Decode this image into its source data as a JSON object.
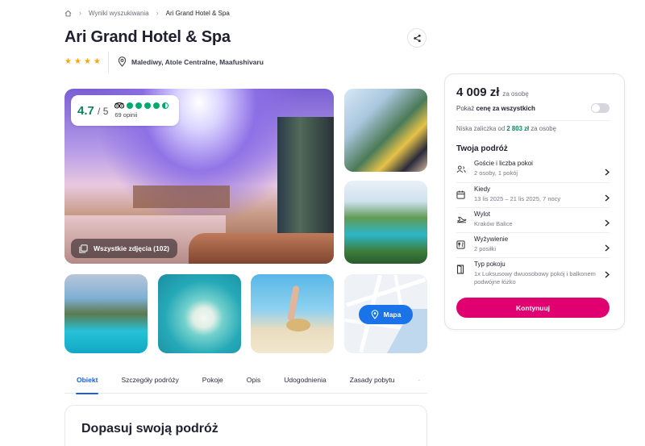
{
  "breadcrumb": {
    "home_icon": "home-icon",
    "items": [
      "Wyniki wyszukiwania",
      "Ari Grand Hotel & Spa"
    ]
  },
  "hotel": {
    "name": "Ari Grand Hotel & Spa",
    "stars": 4,
    "location": "Malediwy, Atole Centralne, Maafushivaru"
  },
  "rating": {
    "score": "4.7",
    "out_of": "/ 5",
    "reviews": "69 opinii",
    "bubbles": 4.5,
    "color": "#00aa6c"
  },
  "gallery": {
    "all_photos_label": "Wszystkie zdjęcia (102)",
    "map_label": "Mapa"
  },
  "tabs": [
    "Obiekt",
    "Szczegóły podróży",
    "Pokoje",
    "Opis",
    "Udogodnienia",
    "Zasady pobytu"
  ],
  "section": {
    "title": "Dopasuj swoją podróż"
  },
  "booking": {
    "price": "4 009 zł",
    "price_per": "za osobę",
    "toggle_prefix": "Pokaż",
    "toggle_bold": "cenę za wszystkich",
    "deposit_prefix": "Niska zaliczka od",
    "deposit_amount": "2 803 zł",
    "deposit_suffix": "za osobę",
    "trip_title": "Twoja podróż",
    "options": [
      {
        "label": "Goście i liczba pokoi",
        "value": "2 osoby, 1 pokój",
        "icon": "guests-icon"
      },
      {
        "label": "Kiedy",
        "value": "13 lis 2025 – 21 lis 2025, 7 nocy",
        "icon": "calendar-icon"
      },
      {
        "label": "Wylot",
        "value": "Kraków Balice",
        "icon": "plane-icon"
      },
      {
        "label": "Wyżywienie",
        "value": "2 posiłki",
        "icon": "meal-icon"
      },
      {
        "label": "Typ pokoju",
        "value": "1x Luksusowy dwuosobowy pokój i balkonem podwójne łóżko",
        "icon": "door-icon"
      }
    ],
    "cta": "Kontynuuj"
  },
  "colors": {
    "accent": "#e0006f",
    "link": "#1d5fd6",
    "star": "#f3a712",
    "green": "#12805c",
    "map_button": "#1a73e8"
  }
}
